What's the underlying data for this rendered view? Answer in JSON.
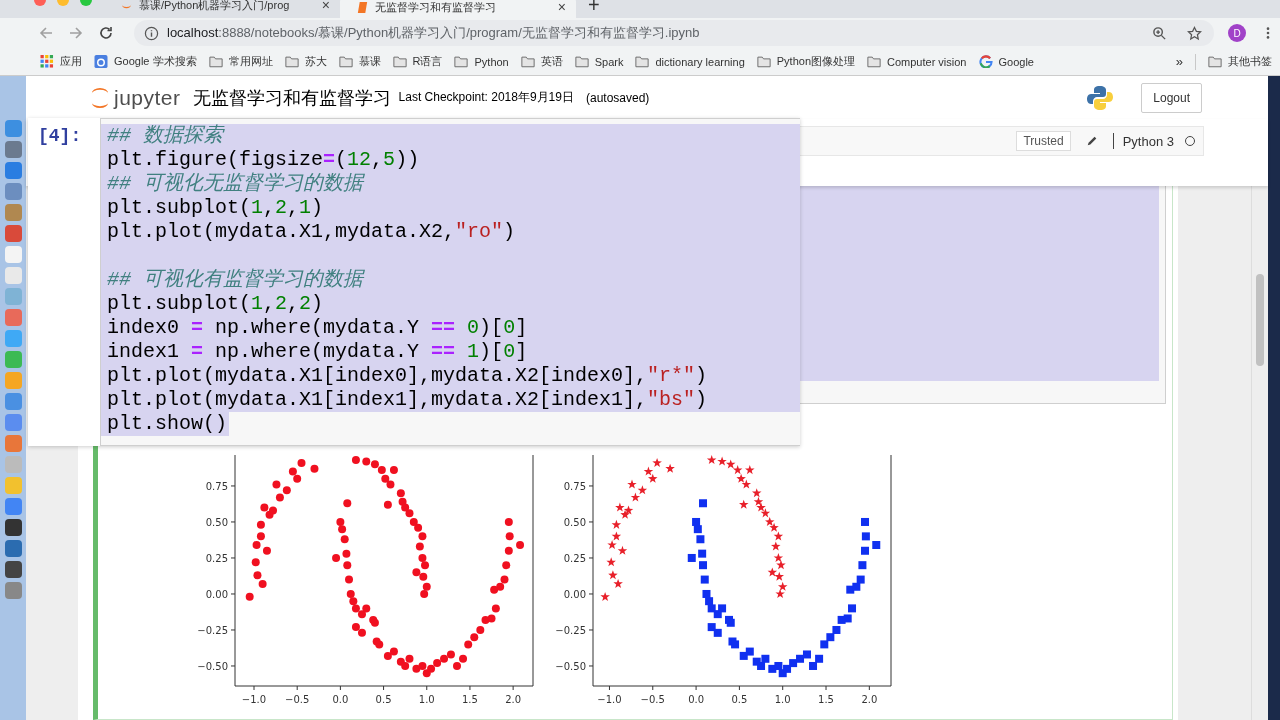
{
  "browser": {
    "tabs": [
      {
        "title": "慕课/Python机器学习入门/prog",
        "selected": false,
        "kind": "jupyter"
      },
      {
        "title": "无监督学习和有监督学习",
        "selected": true,
        "kind": "notebook"
      }
    ],
    "tab_close": "×",
    "new_tab": "+",
    "address": {
      "host": "localhost",
      "path": ":8888/notebooks/慕课/Python机器学习入门/program/无监督学习和有监督学习.ipynb"
    },
    "profile": "D",
    "bookmarks": [
      {
        "label": "应用",
        "kind": "apps"
      },
      {
        "label": "Google 学术搜索",
        "kind": "scholar"
      },
      {
        "label": "常用网址",
        "kind": "folder"
      },
      {
        "label": "苏大",
        "kind": "folder"
      },
      {
        "label": "慕课",
        "kind": "folder"
      },
      {
        "label": "R语言",
        "kind": "folder"
      },
      {
        "label": "Python",
        "kind": "folder"
      },
      {
        "label": "英语",
        "kind": "folder"
      },
      {
        "label": "Spark",
        "kind": "folder"
      },
      {
        "label": "dictionary learning",
        "kind": "folder"
      },
      {
        "label": "Python图像处理",
        "kind": "folder"
      },
      {
        "label": "Computer vision",
        "kind": "folder"
      },
      {
        "label": "Google",
        "kind": "google"
      }
    ],
    "bookmarks_more": "»",
    "other_bookmarks": "其他书签"
  },
  "notebook": {
    "logo": "jupyter",
    "title": "无监督学习和有监督学习",
    "checkpoint": "Last Checkpoint: 2018年9月19日",
    "autosave": "(autosaved)",
    "logout": "Logout",
    "trusted": "Trusted",
    "kernel": "Python 3",
    "kernel_busy": false,
    "cell": {
      "prompt": "[4]:",
      "lines": [
        {
          "kind": "code",
          "tokens": [
            {
              "kind": "comment",
              "text": "## 数据探索"
            }
          ]
        },
        {
          "kind": "code",
          "tokens": [
            {
              "kind": "plain",
              "text": "plt.figure(figsize"
            },
            {
              "kind": "operator",
              "text": "="
            },
            {
              "kind": "plain",
              "text": "("
            },
            {
              "kind": "number",
              "text": "12"
            },
            {
              "kind": "plain",
              "text": ","
            },
            {
              "kind": "number",
              "text": "5"
            },
            {
              "kind": "plain",
              "text": "))"
            }
          ]
        },
        {
          "kind": "code",
          "tokens": [
            {
              "kind": "comment",
              "text": "## 可视化无监督学习的数据"
            }
          ]
        },
        {
          "kind": "code",
          "tokens": [
            {
              "kind": "plain",
              "text": "plt.subplot("
            },
            {
              "kind": "number",
              "text": "1"
            },
            {
              "kind": "plain",
              "text": ","
            },
            {
              "kind": "number",
              "text": "2"
            },
            {
              "kind": "plain",
              "text": ","
            },
            {
              "kind": "number",
              "text": "1"
            },
            {
              "kind": "plain",
              "text": ")"
            }
          ]
        },
        {
          "kind": "code",
          "tokens": [
            {
              "kind": "plain",
              "text": "plt.plot(mydata.X1,mydata.X2,"
            },
            {
              "kind": "string",
              "text": "\"ro\""
            },
            {
              "kind": "plain",
              "text": ")"
            }
          ]
        },
        {
          "kind": "blank"
        },
        {
          "kind": "code",
          "tokens": [
            {
              "kind": "comment",
              "text": "## 可视化有监督学习的数据"
            }
          ]
        },
        {
          "kind": "code",
          "tokens": [
            {
              "kind": "plain",
              "text": "plt.subplot("
            },
            {
              "kind": "number",
              "text": "1"
            },
            {
              "kind": "plain",
              "text": ","
            },
            {
              "kind": "number",
              "text": "2"
            },
            {
              "kind": "plain",
              "text": ","
            },
            {
              "kind": "number",
              "text": "2"
            },
            {
              "kind": "plain",
              "text": ")"
            }
          ]
        },
        {
          "kind": "code",
          "tokens": [
            {
              "kind": "plain",
              "text": "index0 "
            },
            {
              "kind": "operator",
              "text": "="
            },
            {
              "kind": "plain",
              "text": " np.where(mydata.Y "
            },
            {
              "kind": "operator",
              "text": "== "
            },
            {
              "kind": "number",
              "text": "0"
            },
            {
              "kind": "plain",
              "text": ")["
            },
            {
              "kind": "number",
              "text": "0"
            },
            {
              "kind": "plain",
              "text": "]"
            }
          ]
        },
        {
          "kind": "code",
          "tokens": [
            {
              "kind": "plain",
              "text": "index1 "
            },
            {
              "kind": "operator",
              "text": "="
            },
            {
              "kind": "plain",
              "text": " np.where(mydata.Y "
            },
            {
              "kind": "operator",
              "text": "== "
            },
            {
              "kind": "number",
              "text": "1"
            },
            {
              "kind": "plain",
              "text": ")["
            },
            {
              "kind": "number",
              "text": "0"
            },
            {
              "kind": "plain",
              "text": "]"
            }
          ]
        },
        {
          "kind": "code",
          "tokens": [
            {
              "kind": "plain",
              "text": "plt.plot(mydata.X1[index0],mydata.X2[index0],"
            },
            {
              "kind": "string",
              "text": "\"r*\""
            },
            {
              "kind": "plain",
              "text": ")"
            }
          ]
        },
        {
          "kind": "code",
          "tokens": [
            {
              "kind": "plain",
              "text": "plt.plot(mydata.X1[index1],mydata.X2[index1],"
            },
            {
              "kind": "string",
              "text": "\"bs\""
            },
            {
              "kind": "plain",
              "text": ")"
            }
          ]
        },
        {
          "kind": "code",
          "tokens": [
            {
              "kind": "plain",
              "text": "plt.show()"
            }
          ]
        }
      ]
    },
    "charts": [
      {
        "chart_data": {
          "type": "scatter",
          "xlim": [
            -1.22,
            2.23
          ],
          "ylim": [
            -0.639,
            0.965
          ],
          "xticks": [
            {
              "value": -1,
              "label": "−1.0"
            },
            {
              "value": -0.5,
              "label": "−0.5"
            },
            {
              "value": 0,
              "label": "0.0"
            },
            {
              "value": 0.5,
              "label": "0.5"
            },
            {
              "value": 1,
              "label": "1.0"
            },
            {
              "value": 1.5,
              "label": "1.5"
            },
            {
              "value": 2,
              "label": "2.0"
            }
          ],
          "yticks": [
            {
              "value": -0.5,
              "label": "−0.50"
            },
            {
              "value": -0.25,
              "label": "−0.25"
            },
            {
              "value": 0,
              "label": "0.00"
            },
            {
              "value": 0.25,
              "label": "0.25"
            },
            {
              "value": 0.5,
              "label": "0.50"
            },
            {
              "value": 0.75,
              "label": "0.75"
            }
          ],
          "series": [
            {
              "marker": "circle",
              "color": "#f01020",
              "x": [
                -1.05,
                -0.98,
                -0.96,
                -0.92,
                -0.9,
                -0.88,
                -0.82,
                -0.78,
                -0.74,
                -0.7,
                -0.62,
                -0.55,
                -0.5,
                -0.45,
                -0.3,
                -0.92,
                -0.85,
                -0.97,
                0.18,
                0.3,
                0.4,
                0.48,
                0.52,
                0.58,
                0.62,
                0.7,
                0.72,
                0.8,
                0.85,
                0.9,
                0.95,
                0.92,
                0.95,
                0.98,
                0.96,
                1.0,
                0.97,
                0.55,
                0.88,
                0.75
              ],
              "values": [
                -0.02,
                0.22,
                0.13,
                0.4,
                0.07,
                0.6,
                0.55,
                0.58,
                0.76,
                0.67,
                0.72,
                0.85,
                0.8,
                0.91,
                0.87,
                0.48,
                0.3,
                0.34,
                0.93,
                0.92,
                0.9,
                0.86,
                0.8,
                0.76,
                0.86,
                0.7,
                0.64,
                0.56,
                0.5,
                0.46,
                0.4,
                0.33,
                0.25,
                0.2,
                0.12,
                0.05,
                0.0,
                0.62,
                0.15,
                0.6
              ]
            },
            {
              "marker": "circle",
              "color": "#f01020",
              "x": [
                0.0,
                0.02,
                0.05,
                0.07,
                0.08,
                0.1,
                -0.05,
                0.08,
                0.12,
                0.15,
                0.18,
                0.25,
                0.3,
                0.38,
                0.4,
                0.42,
                0.45,
                0.55,
                0.62,
                0.7,
                0.75,
                0.8,
                0.88,
                0.95,
                1.0,
                1.05,
                1.12,
                1.2,
                1.28,
                1.35,
                1.42,
                1.48,
                1.55,
                1.62,
                1.68,
                1.75,
                1.8,
                1.78,
                1.85,
                1.9,
                1.92,
                1.95,
                1.96,
                1.95,
                2.08,
                0.18,
                0.25
              ],
              "values": [
                0.5,
                0.45,
                0.38,
                0.28,
                0.2,
                0.1,
                0.25,
                0.63,
                0.0,
                -0.05,
                -0.1,
                -0.14,
                -0.1,
                -0.18,
                -0.2,
                -0.33,
                -0.35,
                -0.43,
                -0.4,
                -0.47,
                -0.5,
                -0.45,
                -0.52,
                -0.5,
                -0.55,
                -0.52,
                -0.48,
                -0.45,
                -0.42,
                -0.5,
                -0.45,
                -0.35,
                -0.3,
                -0.25,
                -0.18,
                -0.17,
                -0.1,
                0.03,
                0.05,
                0.1,
                0.2,
                0.3,
                0.4,
                0.5,
                0.34,
                -0.23,
                -0.27
              ]
            }
          ]
        }
      },
      {
        "chart_data": {
          "type": "scatter",
          "xlim": [
            -1.19,
            2.25
          ],
          "ylim": [
            -0.639,
            0.965
          ],
          "xticks": [
            {
              "value": -1,
              "label": "−1.0"
            },
            {
              "value": -0.5,
              "label": "−0.5"
            },
            {
              "value": 0,
              "label": "0.0"
            },
            {
              "value": 0.5,
              "label": "0.5"
            },
            {
              "value": 1,
              "label": "1.0"
            },
            {
              "value": 1.5,
              "label": "1.5"
            },
            {
              "value": 2,
              "label": "2.0"
            }
          ],
          "yticks": [
            {
              "value": -0.5,
              "label": "−0.50"
            },
            {
              "value": -0.25,
              "label": "−0.25"
            },
            {
              "value": 0,
              "label": "0.00"
            },
            {
              "value": 0.25,
              "label": "0.25"
            },
            {
              "value": 0.5,
              "label": "0.50"
            },
            {
              "value": 0.75,
              "label": "0.75"
            }
          ],
          "series": [
            {
              "marker": "star",
              "color": "#e8202a",
              "x": [
                -1.05,
                -0.98,
                -0.96,
                -0.92,
                -0.9,
                -0.88,
                -0.82,
                -0.78,
                -0.74,
                -0.7,
                -0.62,
                -0.55,
                -0.5,
                -0.45,
                -0.3,
                -0.92,
                -0.85,
                -0.97,
                0.18,
                0.3,
                0.4,
                0.48,
                0.52,
                0.58,
                0.62,
                0.7,
                0.72,
                0.8,
                0.85,
                0.9,
                0.95,
                0.92,
                0.95,
                0.98,
                0.96,
                1.0,
                0.97,
                0.55,
                0.88,
                0.75
              ],
              "values": [
                -0.02,
                0.22,
                0.13,
                0.4,
                0.07,
                0.6,
                0.55,
                0.58,
                0.76,
                0.67,
                0.72,
                0.85,
                0.8,
                0.91,
                0.87,
                0.48,
                0.3,
                0.34,
                0.93,
                0.92,
                0.9,
                0.86,
                0.8,
                0.76,
                0.86,
                0.7,
                0.64,
                0.56,
                0.5,
                0.46,
                0.4,
                0.33,
                0.25,
                0.2,
                0.12,
                0.05,
                0.0,
                0.62,
                0.15,
                0.6
              ]
            },
            {
              "marker": "square",
              "color": "#1030f0",
              "x": [
                0.0,
                0.02,
                0.05,
                0.07,
                0.08,
                0.1,
                -0.05,
                0.08,
                0.12,
                0.15,
                0.18,
                0.25,
                0.3,
                0.38,
                0.4,
                0.42,
                0.45,
                0.55,
                0.62,
                0.7,
                0.75,
                0.8,
                0.88,
                0.95,
                1.0,
                1.05,
                1.12,
                1.2,
                1.28,
                1.35,
                1.42,
                1.48,
                1.55,
                1.62,
                1.68,
                1.75,
                1.8,
                1.78,
                1.85,
                1.9,
                1.92,
                1.95,
                1.96,
                1.95,
                2.08,
                0.18,
                0.25
              ],
              "values": [
                0.5,
                0.45,
                0.38,
                0.28,
                0.2,
                0.1,
                0.25,
                0.63,
                0.0,
                -0.05,
                -0.1,
                -0.14,
                -0.1,
                -0.18,
                -0.2,
                -0.33,
                -0.35,
                -0.43,
                -0.4,
                -0.47,
                -0.5,
                -0.45,
                -0.52,
                -0.5,
                -0.55,
                -0.52,
                -0.48,
                -0.45,
                -0.42,
                -0.5,
                -0.45,
                -0.35,
                -0.3,
                -0.25,
                -0.18,
                -0.17,
                -0.1,
                0.03,
                0.05,
                0.1,
                0.2,
                0.3,
                0.4,
                0.5,
                0.34,
                -0.23,
                -0.27
              ]
            }
          ]
        }
      }
    ]
  }
}
